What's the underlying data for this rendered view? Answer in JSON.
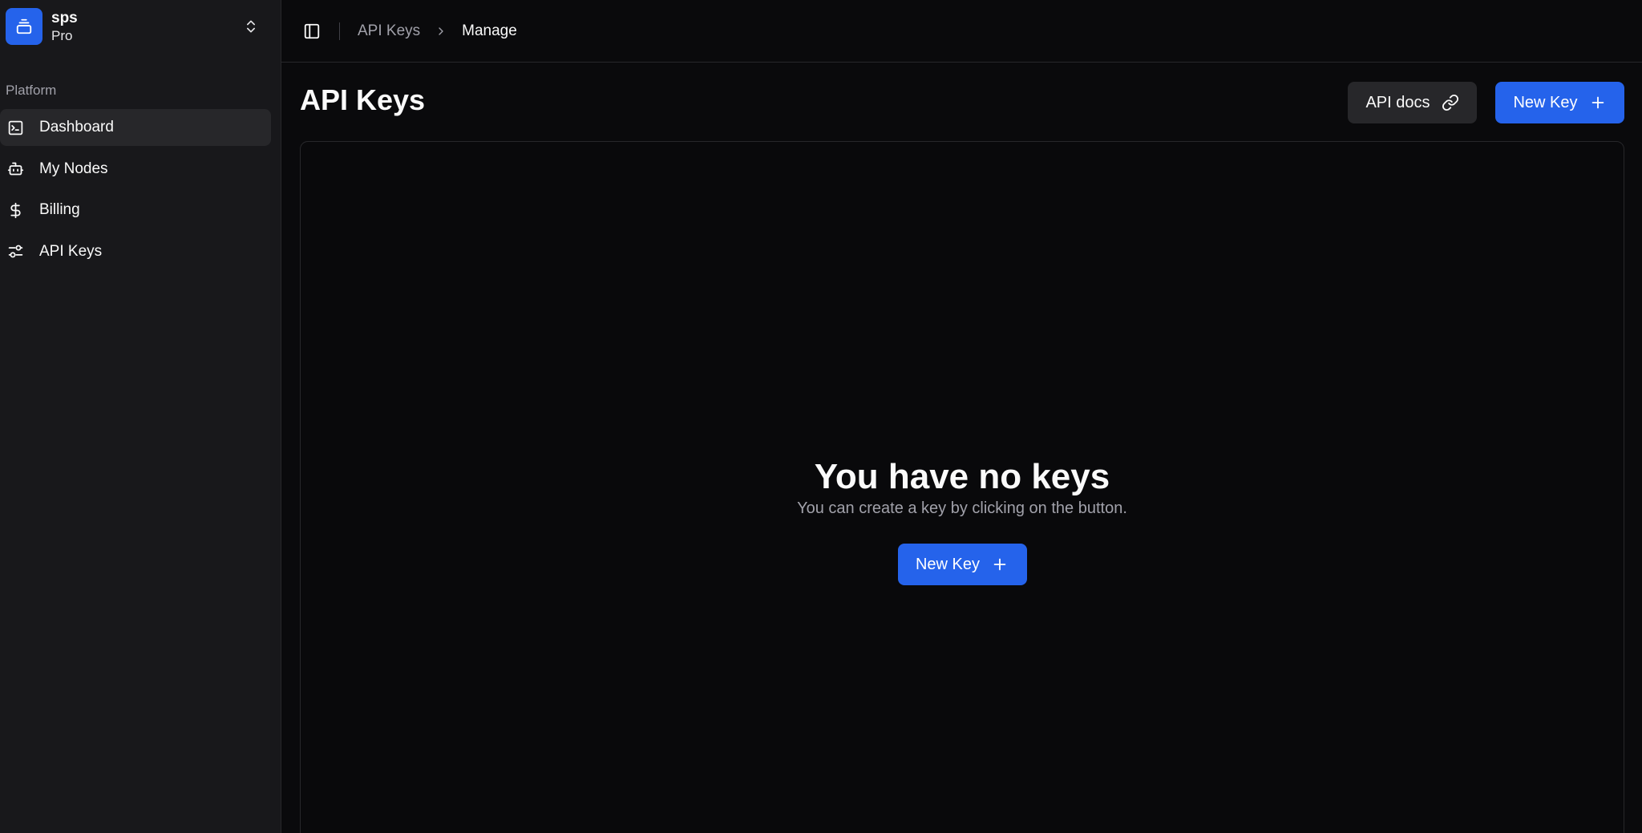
{
  "team": {
    "name": "sps",
    "plan": "Pro"
  },
  "sidebar": {
    "group_label": "Platform",
    "items": [
      {
        "label": "Dashboard",
        "icon": "terminal-square-icon",
        "active": true
      },
      {
        "label": "My Nodes",
        "icon": "bot-icon",
        "active": false
      },
      {
        "label": "Billing",
        "icon": "dollar-sign-icon",
        "active": false
      },
      {
        "label": "API Keys",
        "icon": "sliders-icon",
        "active": false
      }
    ]
  },
  "breadcrumb": {
    "parent": "API Keys",
    "current": "Manage"
  },
  "header": {
    "title": "API Keys",
    "docs_label": "API docs",
    "new_key_label": "New Key"
  },
  "empty_state": {
    "title": "You have no keys",
    "subtitle": "You can create a key by clicking on the button.",
    "button_label": "New Key"
  },
  "colors": {
    "accent": "#2563eb",
    "sidebar_bg": "#18181b",
    "main_bg": "#0a0a0c"
  }
}
